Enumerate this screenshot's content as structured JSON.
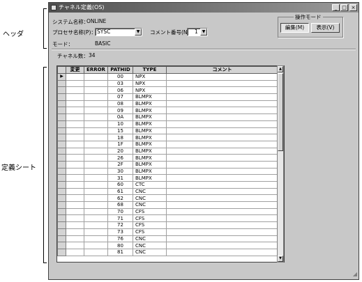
{
  "annotations": {
    "header_label": "ヘッダ",
    "sheet_label": "定義シート"
  },
  "window": {
    "title": "チャネル定義(OS)",
    "minimize_glyph": "_",
    "maximize_glyph": "□",
    "close_glyph": "×"
  },
  "header": {
    "system_name_label": "システム名称：",
    "system_name_value": "ONLINE",
    "processor_label": "プロセサ名称(P)：",
    "processor_value": "SYSC",
    "comment_no_label": "コメント番号(N)：",
    "comment_no_value": "1",
    "mode_label": "モード：",
    "mode_value": "BASIC",
    "channel_count_label": "チャネル数：",
    "channel_count_value": "34"
  },
  "operation_mode": {
    "legend": "操作モード",
    "edit_button": "編集(M)",
    "display_button": "表示(V)"
  },
  "grid": {
    "columns": [
      "変更",
      "ERROR",
      "PATHID",
      "TYPE",
      "コメント"
    ],
    "rows": [
      {
        "pathid": "00",
        "type": "NPX"
      },
      {
        "pathid": "03",
        "type": "NPX"
      },
      {
        "pathid": "06",
        "type": "NPX"
      },
      {
        "pathid": "07",
        "type": "BLMPX"
      },
      {
        "pathid": "08",
        "type": "BLMPX"
      },
      {
        "pathid": "09",
        "type": "BLMPX"
      },
      {
        "pathid": "0A",
        "type": "BLMPX"
      },
      {
        "pathid": "10",
        "type": "BLMPX"
      },
      {
        "pathid": "15",
        "type": "BLMPX"
      },
      {
        "pathid": "18",
        "type": "BLMPX"
      },
      {
        "pathid": "1F",
        "type": "BLMPX"
      },
      {
        "pathid": "20",
        "type": "BLMPX"
      },
      {
        "pathid": "26",
        "type": "BLMPX"
      },
      {
        "pathid": "2F",
        "type": "BLMPX"
      },
      {
        "pathid": "30",
        "type": "BLMPX"
      },
      {
        "pathid": "31",
        "type": "BLMPX"
      },
      {
        "pathid": "60",
        "type": "CTC"
      },
      {
        "pathid": "61",
        "type": "CNC"
      },
      {
        "pathid": "62",
        "type": "CNC"
      },
      {
        "pathid": "68",
        "type": "CNC"
      },
      {
        "pathid": "70",
        "type": "CFS"
      },
      {
        "pathid": "71",
        "type": "CFS"
      },
      {
        "pathid": "72",
        "type": "CFS"
      },
      {
        "pathid": "73",
        "type": "CFS"
      },
      {
        "pathid": "76",
        "type": "CNC"
      },
      {
        "pathid": "80",
        "type": "CNC"
      },
      {
        "pathid": "81",
        "type": "CNC"
      }
    ],
    "current_row_marker": "▶"
  },
  "scrollbar": {
    "up_glyph": "▲",
    "down_glyph": "▼"
  }
}
